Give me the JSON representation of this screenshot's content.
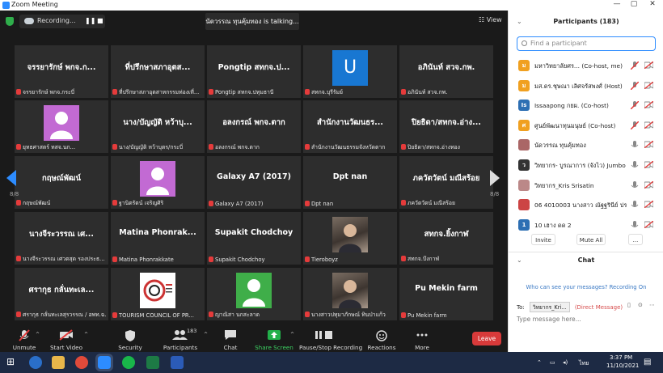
{
  "window": {
    "title": "Zoom Meeting",
    "minimize": "—",
    "maximize": "▢",
    "close": "✕"
  },
  "topbar": {
    "recording_label": "Recording...",
    "pause_glyph": "❚❚",
    "stop_glyph": "■",
    "talking": "นัดวรรณ ทุนคุ้มทอง is talking...",
    "view_label": "View"
  },
  "grid": {
    "page_left": "8/8",
    "page_right": "8/8",
    "tiles": [
      {
        "name": "จรรยารักษ์ พกจ.ก...",
        "label": "จรรยารักษ์ พกจ.กระบี่"
      },
      {
        "name": "ที่ปรึกษาสภาอุตส...",
        "label": "ที่ปรึกษาสภาอุตสาหกรรมท่องเที่..."
      },
      {
        "name": "Pongtip สทกจ.ป...",
        "label": "Pongtip สทกจ.ปทุมธานี"
      },
      {
        "name": "",
        "label": "สทกจ.บุรีรัมย์",
        "avatar": "U",
        "avatar_color": "#1877d2"
      },
      {
        "name": "อภินันท์ สวจ.กพ.",
        "label": "อภินันท์ สวจ.กพ."
      },
      {
        "name": "",
        "label": "ยุทธศาสตร์ ทสจ.นก...",
        "avatar": "person",
        "avatar_color": "#c26ad3"
      },
      {
        "name": "นาง/บัญญัติ หว้าบุ...",
        "label": "นาง/บัญญัติ หว้าบุตร/กระบี่"
      },
      {
        "name": "อลงกรณ์ พกจ.ตาก",
        "label": "อลงกรณ์ พกจ.ตาก"
      },
      {
        "name": "สำนักงานวัฒนธร...",
        "label": "สำนักงานวัฒนธรรมจังหวัดตาก"
      },
      {
        "name": "ปิยธิดา/สทกจ.อ่าง...",
        "label": "ปิยธิดา/สทกจ.อ่างทอง"
      },
      {
        "name": "กฤษณ์พัฒน์",
        "label": "กฤษณ์พัฒน์"
      },
      {
        "name": "",
        "label": "ฐานิตรัตน์ เจริญศิริ",
        "avatar": "person",
        "avatar_color": "#c26ad3"
      },
      {
        "name": "Galaxy A7 (2017)",
        "label": "Galaxy A7 (2017)"
      },
      {
        "name": "Dpt nan",
        "label": "Dpt nan"
      },
      {
        "name": "ภควัตวัตน์ มณีสร้อย",
        "label": "ภควัตวัตน์ มณีสร้อย"
      },
      {
        "name": "นางจีระวรรณ เศ...",
        "label": "นางจีระวรรณ เศวตสุด รองประธ..."
      },
      {
        "name": "Matina Phonrak...",
        "label": "Matina Phonrakkate"
      },
      {
        "name": "Supakit Chodchoy",
        "label": "Supakit Chodchoy"
      },
      {
        "name": "",
        "label": "Tieroboyz",
        "photo": true
      },
      {
        "name": "สทกจ.ยิ้งกาฬ",
        "label": "สทกจ.บึงกาฬ"
      },
      {
        "name": "ศรากุธ กลั่นทะเล...",
        "label": "ศรากุธ กลั่นทะเลสุรวรรณ / อพท.ฉ..."
      },
      {
        "name": "",
        "label": "TOURISM COUNCIL OF PR...",
        "logo": true
      },
      {
        "name": "",
        "label": "ญาณิสา นกสะลาด",
        "avatar": "person",
        "avatar_color": "#3fae49"
      },
      {
        "name": "",
        "label": "นางสาวปทุมาภักษณ์ ทินป่าแก้ว",
        "photo": true
      },
      {
        "name": "Pu Mekin farm",
        "label": "Pu Mekin farm"
      }
    ]
  },
  "toolbar": {
    "items": [
      {
        "label": "Unmute",
        "icon": "mic-muted-icon"
      },
      {
        "label": "Start Video",
        "icon": "video-off-icon"
      },
      {
        "label": "Security",
        "icon": "shield-icon"
      },
      {
        "label": "Participants",
        "icon": "participants-icon",
        "count": "183"
      },
      {
        "label": "Chat",
        "icon": "chat-icon"
      },
      {
        "label": "Share Screen",
        "icon": "share-screen-icon"
      },
      {
        "label": "Pause/Stop Recording",
        "icon": "recording-icon"
      },
      {
        "label": "Reactions",
        "icon": "reactions-icon"
      },
      {
        "label": "More",
        "icon": "more-icon"
      }
    ],
    "leave": "Leave"
  },
  "participants": {
    "title": "Participants (183)",
    "search_placeholder": "Find a participant",
    "list": [
      {
        "initial": "ม",
        "color": "#f0a020",
        "name": "มหาวิทยาลัยศร... (Co-host, me)"
      },
      {
        "initial": "ม",
        "color": "#f0a020",
        "name": "มส.ดร.ชุษณา เลิศจรัสพงศ์ (Host)"
      },
      {
        "initial": "Is",
        "color": "#2d6fb3",
        "name": "Issaapong กยผ. (Co-host)"
      },
      {
        "initial": "ศ",
        "color": "#f0a020",
        "name": "ศูนย์พัฒนาทุนมนุษย์ (Co-host)"
      },
      {
        "initial": "",
        "color": "#a66",
        "name": "นัดวรรณ ทุนคุ้มทอง"
      },
      {
        "initial": "ว",
        "color": "#333",
        "name": "วิทยากร- บูรณาการ (จังไว) Jumbo ..."
      },
      {
        "initial": "",
        "color": "#b88",
        "name": "วิทยากร_Kris Srisatin"
      },
      {
        "initial": "",
        "color": "#c44",
        "name": "06 4010003 นางสาว ณัฐฐรินีย์ ประ..."
      },
      {
        "initial": "1",
        "color": "#2d6fb3",
        "name": "10 เฮาง ดด 2"
      }
    ],
    "invite": "Invite",
    "mute_all": "Mute All",
    "more": "..."
  },
  "chat": {
    "title": "Chat",
    "who_can_see": "Who can see your messages? Recording On",
    "to_label": "To:",
    "to_value": "วิทยากร_Kri...",
    "direct": "(Direct Message)",
    "placeholder": "Type message here..."
  },
  "taskbar": {
    "time": "3:37 PM",
    "date": "11/10/2021",
    "lang": "ไทย"
  }
}
